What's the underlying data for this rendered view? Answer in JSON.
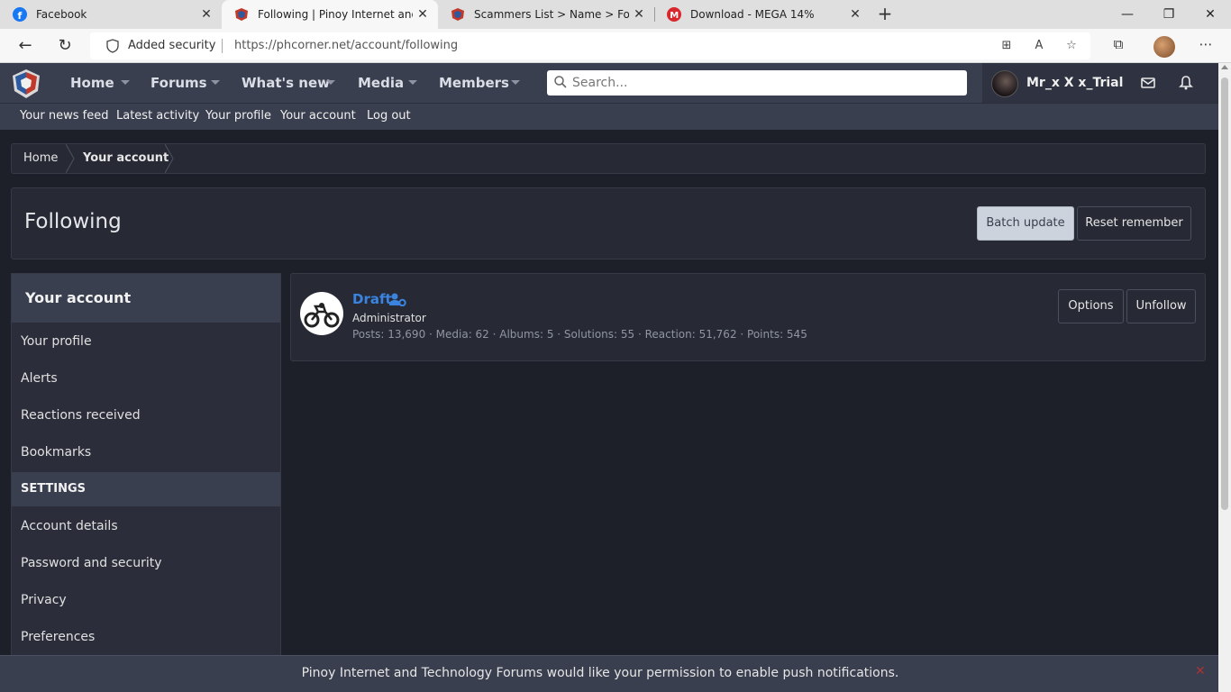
{
  "browser": {
    "tabs": [
      {
        "title": "Facebook",
        "active": false
      },
      {
        "title": "Following | Pinoy Internet and Te",
        "active": true
      },
      {
        "title": "Scammers List > Name > Forum",
        "active": false
      },
      {
        "title": "Download - MEGA 14%",
        "active": false
      }
    ],
    "security_label": "Added security",
    "url": "https://phcorner.net/account/following"
  },
  "site": {
    "nav": [
      "Home",
      "Forums",
      "What's new",
      "Media",
      "Members"
    ],
    "search_placeholder": "Search...",
    "username": "Mr_x X x_Trial",
    "subnav": [
      "Your news feed",
      "Latest activity",
      "Your profile",
      "Your account",
      "Log out"
    ]
  },
  "breadcrumb": [
    "Home",
    "Your account"
  ],
  "page": {
    "title": "Following",
    "batch_update": "Batch update",
    "reset_remember": "Reset remember"
  },
  "sidebar": {
    "header": "Your account",
    "items": [
      "Your profile",
      "Alerts",
      "Reactions received",
      "Bookmarks"
    ],
    "section": "SETTINGS",
    "settings_items": [
      "Account details",
      "Password and security",
      "Privacy",
      "Preferences"
    ]
  },
  "member": {
    "name": "Draft",
    "role": "Administrator",
    "stats": "Posts: 13,690 · Media: 62 · Albums: 5 · Solutions: 55 · Reaction: 51,762 · Points: 545",
    "options": "Options",
    "unfollow": "Unfollow"
  },
  "notice": "Pinoy Internet and Technology Forums would like your permission to enable push notifications.",
  "colors": {
    "accent": "#3a84e0",
    "header": "#3a3f4f",
    "background": "#1e2029"
  }
}
